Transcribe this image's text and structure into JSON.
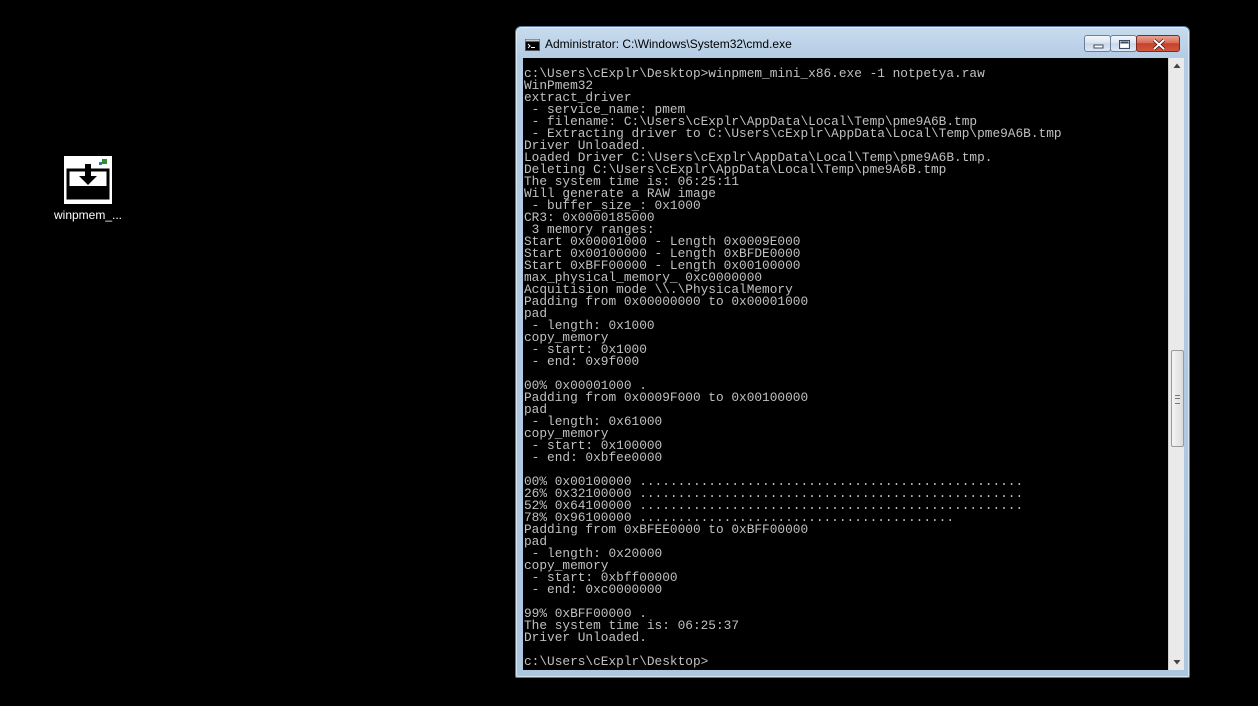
{
  "desktop": {
    "icons": [
      {
        "label": "winpmem_...",
        "icon": "download-tray-icon"
      }
    ]
  },
  "window": {
    "title": "Administrator: C:\\Windows\\System32\\cmd.exe",
    "app_icon": "cmd-icon",
    "controls": {
      "minimize": "minimize-icon",
      "maximize": "maximize-icon",
      "close": "close-icon"
    }
  },
  "console": {
    "lines": [
      "c:\\Users\\cExplr\\Desktop>winpmem_mini_x86.exe -1 notpetya.raw",
      "WinPmem32",
      "extract_driver",
      " - service_name: pmem",
      " - filename: C:\\Users\\cExplr\\AppData\\Local\\Temp\\pme9A6B.tmp",
      " - Extracting driver to C:\\Users\\cExplr\\AppData\\Local\\Temp\\pme9A6B.tmp",
      "Driver Unloaded.",
      "Loaded Driver C:\\Users\\cExplr\\AppData\\Local\\Temp\\pme9A6B.tmp.",
      "Deleting C:\\Users\\cExplr\\AppData\\Local\\Temp\\pme9A6B.tmp",
      "The system time is: 06:25:11",
      "Will generate a RAW image",
      " - buffer_size_: 0x1000",
      "CR3: 0x0000185000",
      " 3 memory ranges:",
      "Start 0x00001000 - Length 0x0009E000",
      "Start 0x00100000 - Length 0xBFDE0000",
      "Start 0xBFF00000 - Length 0x00100000",
      "max_physical_memory_ 0xc0000000",
      "Acquitision mode \\\\.\\PhysicalMemory",
      "Padding from 0x00000000 to 0x00001000",
      "pad",
      " - length: 0x1000",
      "copy_memory",
      " - start: 0x1000",
      " - end: 0x9f000",
      "",
      "00% 0x00001000 .",
      "Padding from 0x0009F000 to 0x00100000",
      "pad",
      " - length: 0x61000",
      "copy_memory",
      " - start: 0x100000",
      " - end: 0xbfee0000",
      "",
      "00% 0x00100000 ..................................................",
      "26% 0x32100000 ..................................................",
      "52% 0x64100000 ..................................................",
      "78% 0x96100000 .........................................",
      "Padding from 0xBFEE0000 to 0xBFF00000",
      "pad",
      " - length: 0x20000",
      "copy_memory",
      " - start: 0xbff00000",
      " - end: 0xc0000000",
      "",
      "99% 0xBFF00000 .",
      "The system time is: 06:25:37",
      "Driver Unloaded.",
      "",
      "c:\\Users\\cExplr\\Desktop>"
    ]
  },
  "scrollbar": {
    "up": "scroll-up-arrow-icon",
    "down": "scroll-down-arrow-icon",
    "grip": "grip-icon",
    "position_fraction": 0.55
  }
}
